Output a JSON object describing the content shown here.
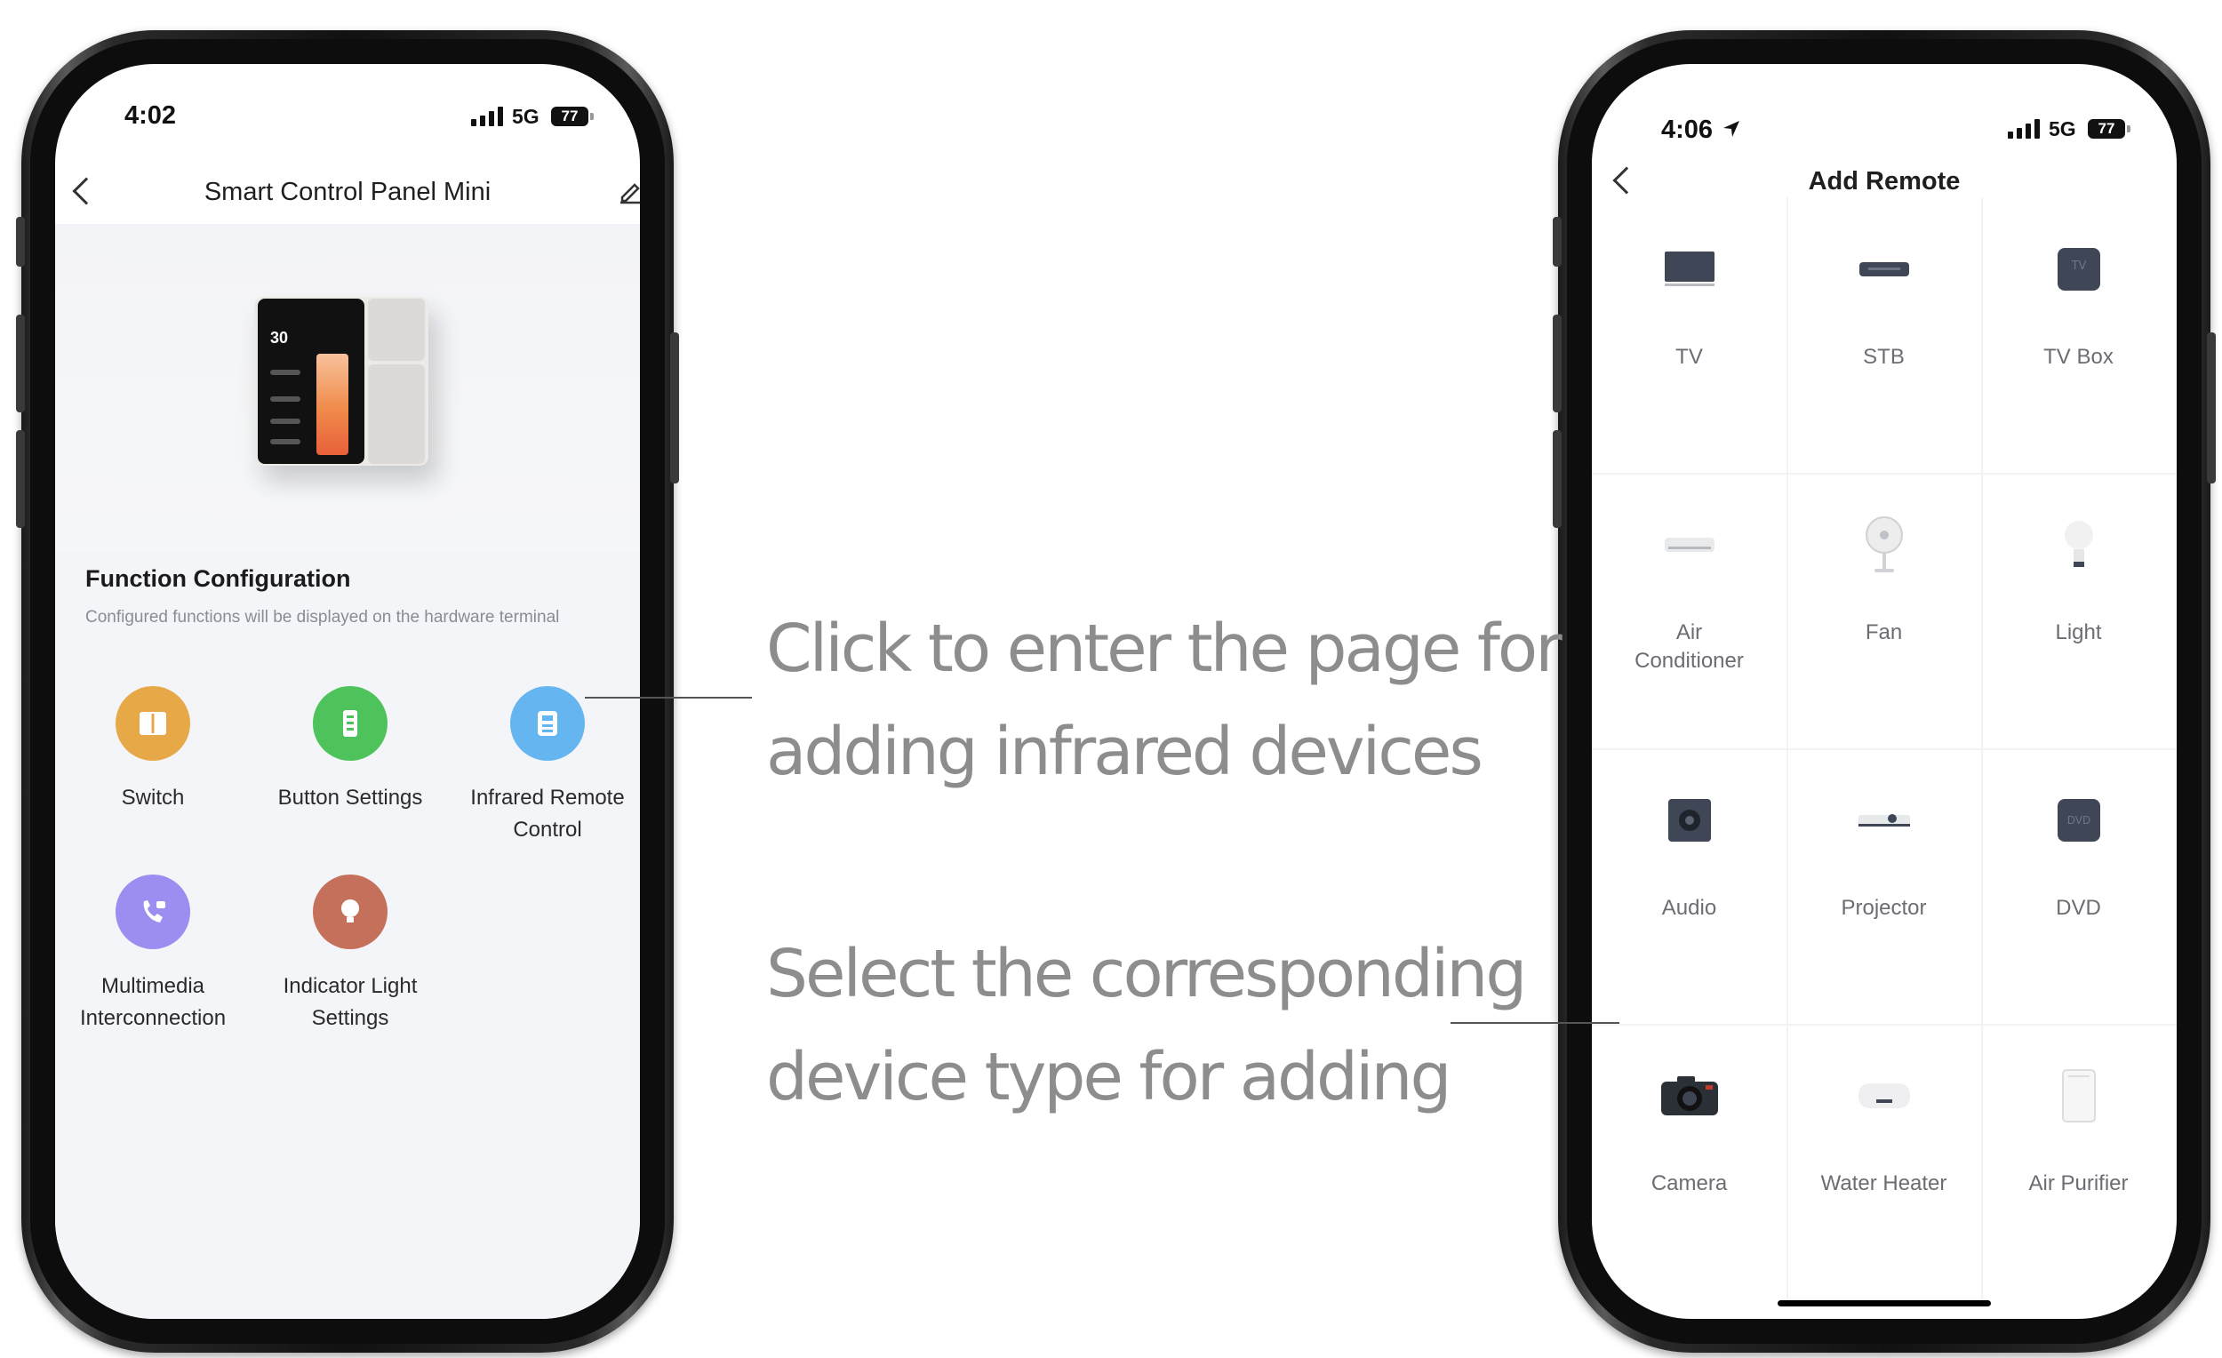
{
  "left_phone": {
    "status": {
      "time": "4:02",
      "network": "5G",
      "battery": "77"
    },
    "nav": {
      "title": "Smart Control Panel Mini"
    },
    "device_screen": {
      "temp": "30"
    },
    "function_config": {
      "title": "Function Configuration",
      "subtitle": "Configured functions will be displayed on the hardware terminal",
      "items": [
        {
          "label": "Switch",
          "icon": "switch-icon",
          "color": "#e7a948"
        },
        {
          "label": "Button Settings",
          "icon": "button-settings-icon",
          "color": "#4fc35b"
        },
        {
          "label": "Infrared Remote Control",
          "icon": "infrared-remote-icon",
          "color": "#65b6f0"
        },
        {
          "label": "Multimedia Interconnection",
          "icon": "multimedia-icon",
          "color": "#9a8ff0"
        },
        {
          "label": "Indicator Light Settings",
          "icon": "indicator-light-icon",
          "color": "#c5705a"
        }
      ]
    }
  },
  "right_phone": {
    "status": {
      "time": "4:06",
      "network": "5G",
      "battery": "77"
    },
    "nav": {
      "title": "Add Remote"
    },
    "devices": [
      {
        "label": "TV",
        "icon": "tv-icon"
      },
      {
        "label": "STB",
        "icon": "stb-icon"
      },
      {
        "label": "TV Box",
        "icon": "tv-box-icon",
        "badge": "TV"
      },
      {
        "label": "Air Conditioner",
        "icon": "air-conditioner-icon"
      },
      {
        "label": "Fan",
        "icon": "fan-icon"
      },
      {
        "label": "Light",
        "icon": "light-bulb-icon"
      },
      {
        "label": "Audio",
        "icon": "audio-speaker-icon"
      },
      {
        "label": "Projector",
        "icon": "projector-icon"
      },
      {
        "label": "DVD",
        "icon": "dvd-icon",
        "badge": "DVD"
      },
      {
        "label": "Camera",
        "icon": "camera-icon"
      },
      {
        "label": "Water Heater",
        "icon": "water-heater-icon"
      },
      {
        "label": "Air Purifier",
        "icon": "air-purifier-icon"
      }
    ]
  },
  "annotations": {
    "top": {
      "line1": "Click to enter the page for",
      "line2": "adding infrared devices"
    },
    "bottom": {
      "line1": "Select the corresponding",
      "line2": "device type for adding"
    }
  },
  "colors": {
    "annotation_text": "#8d8d8d",
    "device_icon": "#3f4756",
    "screen_bg": "#f4f5f8"
  }
}
